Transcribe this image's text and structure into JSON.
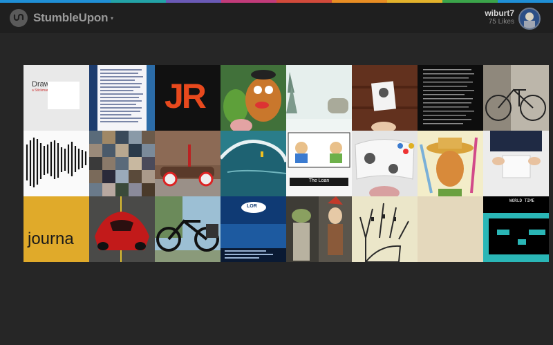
{
  "app": {
    "brand": "StumbleUpon",
    "caret": "▾",
    "stripe_colors": [
      "#1f8fd6",
      "#1f8fd6",
      "#23a3a7",
      "#6a5ab6",
      "#c23b7a",
      "#d24a3b",
      "#e88d23",
      "#e3b22b",
      "#3ba44a",
      "#1f8fd6"
    ]
  },
  "user": {
    "name": "wiburt7",
    "likes": "75 Likes"
  },
  "tiles": {
    "r1": [
      {
        "label": "Draw",
        "sub": "a Stickman"
      },
      {
        "label": ""
      },
      {
        "label": "JR"
      },
      {
        "label": ""
      },
      {
        "label": ""
      },
      {
        "label": ""
      },
      {
        "label": ""
      },
      {
        "label": ""
      }
    ],
    "r2": [
      {
        "label": ""
      },
      {
        "label": ""
      },
      {
        "label": ""
      },
      {
        "label": ""
      },
      {
        "label": "The Loan"
      },
      {
        "label": ""
      },
      {
        "label": ""
      },
      {
        "label": ""
      }
    ],
    "r3": [
      {
        "label": "journa"
      },
      {
        "label": ""
      },
      {
        "label": ""
      },
      {
        "label": "LOR"
      },
      {
        "label": ""
      },
      {
        "label": ""
      },
      {
        "label": ""
      },
      {
        "label": "WORLD TIME"
      }
    ]
  }
}
